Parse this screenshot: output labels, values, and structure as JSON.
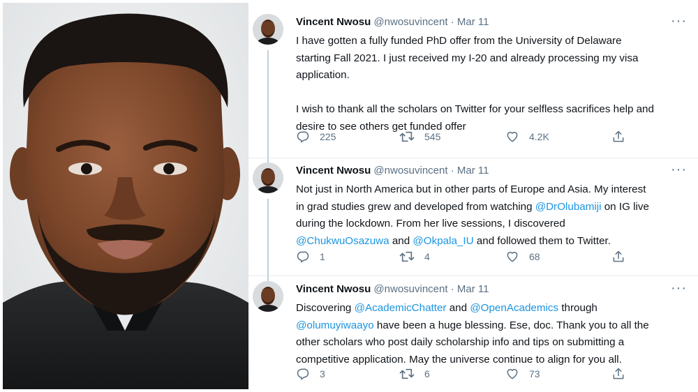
{
  "tweets": [
    {
      "name": "Vincent Nwosu",
      "handle": "@nwosuvincent",
      "separator": "·",
      "date": "Mar 11",
      "more": "···",
      "p1_lines": [
        "I have gotten a fully funded PhD offer from the University of Delaware",
        "starting Fall 2021. I just received my I-20 and already processing my visa",
        "application."
      ],
      "p2_lines": [
        "I wish to thank all the scholars on Twitter for your selfless sacrifices help and",
        "desire to see others get funded offer"
      ],
      "replies": "225",
      "retweets": "545",
      "likes": "4.2K"
    },
    {
      "name": "Vincent Nwosu",
      "handle": "@nwosuvincent",
      "separator": "·",
      "date": "Mar 11",
      "more": "···",
      "line1": "Not just in North America but in other parts of Europe and Asia. My interest",
      "line2a": "in grad studies grew and developed from watching ",
      "line2_link": "@DrOlubamiji",
      "line2b": " on IG live",
      "line3": "during the lockdown. From her live sessions, I discovered",
      "line4_link1": "@ChukwuOsazuwa",
      "line4_mid": " and ",
      "line4_link2": "@Okpala_IU",
      "line4b": " and followed them to Twitter.",
      "replies": "1",
      "retweets": "4",
      "likes": "68"
    },
    {
      "name": "Vincent Nwosu",
      "handle": "@nwosuvincent",
      "separator": "·",
      "date": "Mar 11",
      "more": "···",
      "line1a": "Discovering ",
      "line1_link1": "@AcademicChatter",
      "line1_mid": " and ",
      "line1_link2": "@OpenAcademics",
      "line1b": " through",
      "line2_link": "@olumuyiwaayo",
      "line2b": " have been a huge blessing. Ese, doc. Thank you to all the",
      "line3": "other scholars who post daily scholarship info and tips on submitting a",
      "line4": "competitive application. May the universe continue to align for you all.",
      "replies": "3",
      "retweets": "6",
      "likes": "73"
    }
  ],
  "colors": {
    "text": "#0f1419",
    "muted": "#5b7083",
    "link": "#1b95e0",
    "divider": "#e6ecf0",
    "thread_line": "#c4cfd6"
  }
}
